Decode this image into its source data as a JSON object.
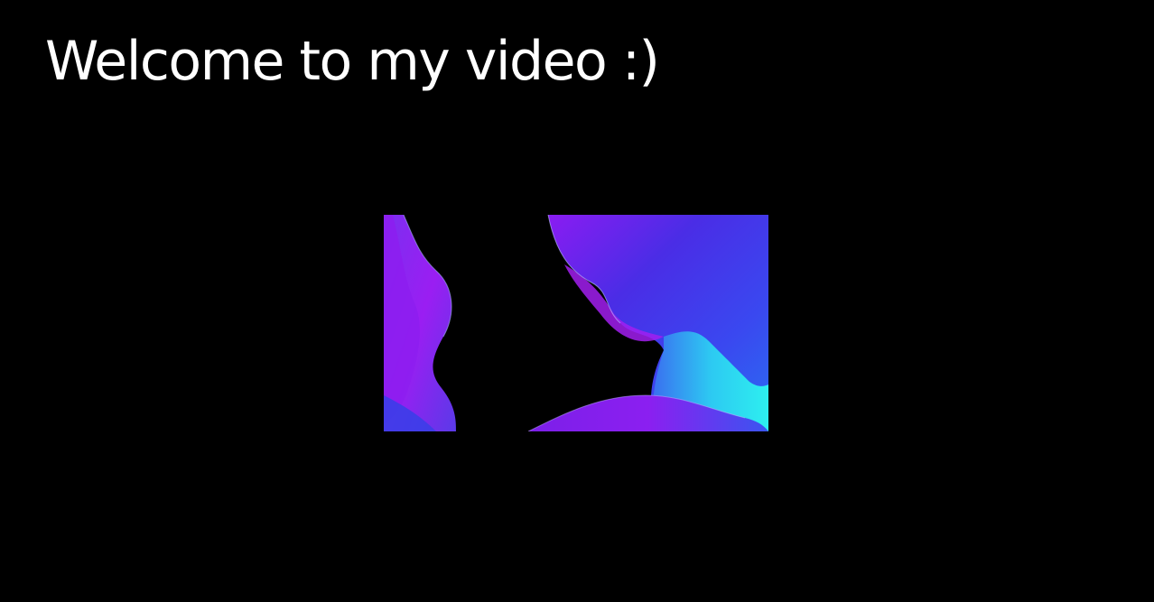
{
  "slide": {
    "title": "Welcome to my video :)"
  },
  "video": {
    "colors": {
      "background": "#000000",
      "violet": "#8a1cf2",
      "purple": "#6a22f0",
      "indigo": "#4a2de6",
      "blue": "#3a3ff0",
      "cyan": "#2de7f0",
      "magenta": "#b31fe6"
    }
  }
}
